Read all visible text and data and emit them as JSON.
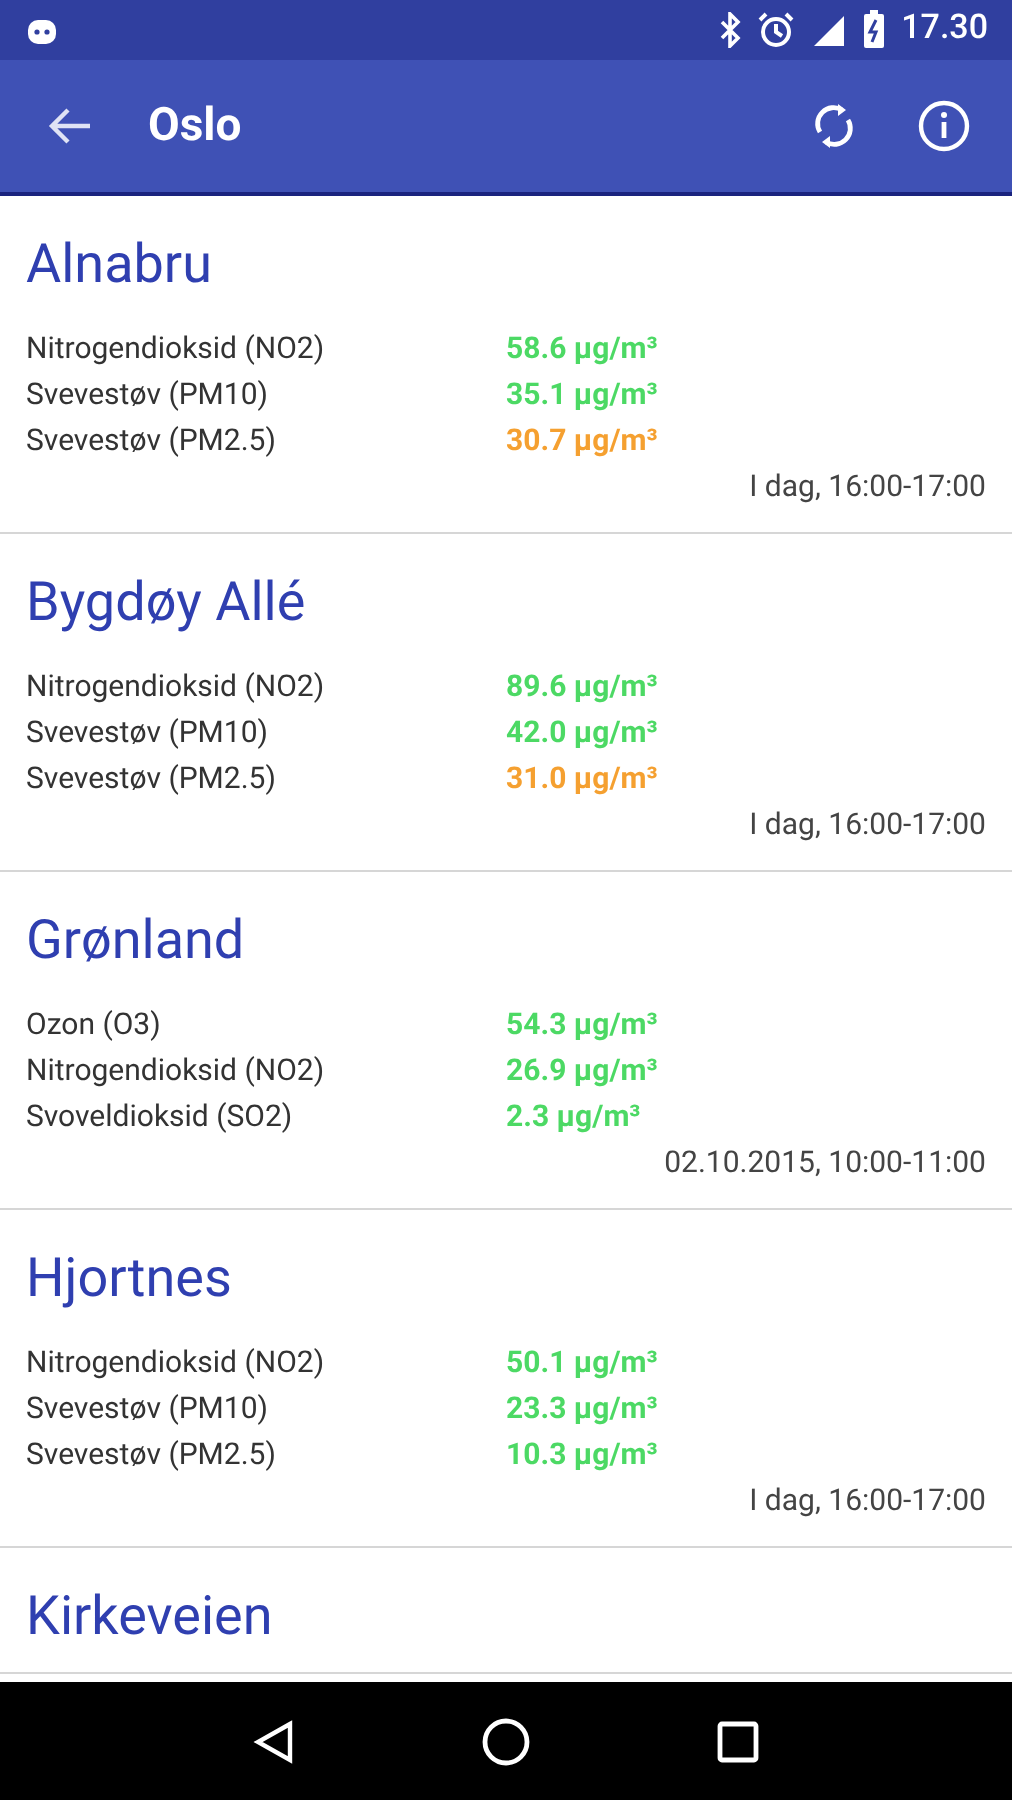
{
  "status_bar": {
    "time": "17.30"
  },
  "app_bar": {
    "title": "Oslo"
  },
  "stations": [
    {
      "name": "Alnabru",
      "readings": [
        {
          "label": "Nitrogendioksid (NO2)",
          "value": "58.6 µg/m³",
          "color": "#4cd964"
        },
        {
          "label": "Svevestøv (PM10)",
          "value": "35.1 µg/m³",
          "color": "#4cd964"
        },
        {
          "label": "Svevestøv (PM2.5)",
          "value": "30.7 µg/m³",
          "color": "#f5a030"
        }
      ],
      "time": "I dag, 16:00-17:00"
    },
    {
      "name": "Bygdøy Allé",
      "readings": [
        {
          "label": "Nitrogendioksid (NO2)",
          "value": "89.6 µg/m³",
          "color": "#4cd964"
        },
        {
          "label": "Svevestøv (PM10)",
          "value": "42.0 µg/m³",
          "color": "#4cd964"
        },
        {
          "label": "Svevestøv (PM2.5)",
          "value": "31.0 µg/m³",
          "color": "#f5a030"
        }
      ],
      "time": "I dag, 16:00-17:00"
    },
    {
      "name": "Grønland",
      "readings": [
        {
          "label": "Ozon (O3)",
          "value": "54.3 µg/m³",
          "color": "#4cd964"
        },
        {
          "label": "Nitrogendioksid (NO2)",
          "value": "26.9 µg/m³",
          "color": "#4cd964"
        },
        {
          "label": "Svoveldioksid (SO2)",
          "value": "2.3 µg/m³",
          "color": "#4cd964"
        }
      ],
      "time": "02.10.2015, 10:00-11:00"
    },
    {
      "name": "Hjortnes",
      "readings": [
        {
          "label": "Nitrogendioksid (NO2)",
          "value": "50.1 µg/m³",
          "color": "#4cd964"
        },
        {
          "label": "Svevestøv (PM10)",
          "value": "23.3 µg/m³",
          "color": "#4cd964"
        },
        {
          "label": "Svevestøv (PM2.5)",
          "value": "10.3 µg/m³",
          "color": "#4cd964"
        }
      ],
      "time": "I dag, 16:00-17:00"
    },
    {
      "name": "Kirkeveien"
    }
  ]
}
